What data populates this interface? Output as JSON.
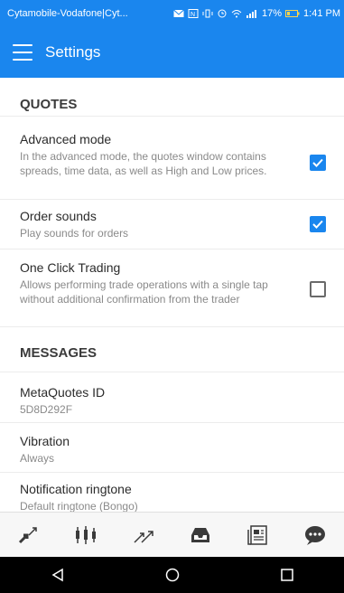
{
  "status_bar": {
    "carrier": "Cytamobile-Vodafone|Cyt...",
    "battery": "17%",
    "time": "1:41 PM"
  },
  "app_bar": {
    "title": "Settings",
    "menu_icon": "hamburger-menu-icon"
  },
  "sections": [
    {
      "header": "QUOTES",
      "items": [
        {
          "title": "Advanced mode",
          "desc": "In the advanced mode, the quotes window contains spreads, time data, as well as High and Low prices.",
          "checked": true
        },
        {
          "title": "Order sounds",
          "desc": "Play sounds for orders",
          "checked": true
        },
        {
          "title": "One Click Trading",
          "desc": "Allows performing trade operations with a single tap without additional confirmation from the trader",
          "checked": false
        }
      ]
    },
    {
      "header": "MESSAGES",
      "items": [
        {
          "title": "MetaQuotes ID",
          "desc": "5D8D292F"
        },
        {
          "title": "Vibration",
          "desc": "Always"
        },
        {
          "title": "Notification ringtone",
          "desc": "Default ringtone (Bongo)"
        }
      ]
    }
  ],
  "bottom_tabs": [
    "quotes-icon",
    "chart-icon",
    "trade-icon",
    "history-icon",
    "news-icon",
    "messages-icon"
  ],
  "nav_buttons": [
    "back-icon",
    "home-icon",
    "recents-icon"
  ],
  "colors": {
    "accent": "#1a86ee",
    "tab_icon": "#3a3a3a"
  }
}
